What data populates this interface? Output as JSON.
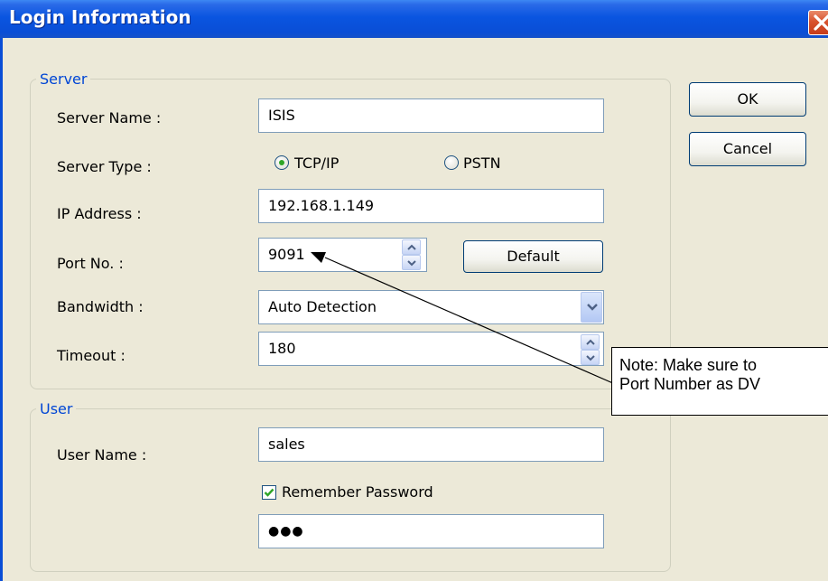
{
  "window": {
    "title": "Login Information"
  },
  "server_group": {
    "legend": "Server",
    "server_name_label": "Server Name :",
    "server_name_value": "ISIS",
    "server_type_label": "Server Type :",
    "server_type_options": [
      {
        "label": "TCP/IP",
        "selected": true
      },
      {
        "label": "PSTN",
        "selected": false
      }
    ],
    "ip_address_label": "IP Address :",
    "ip_address_value": "192.168.1.149",
    "port_label": "Port No. :",
    "port_value": "9091",
    "default_button_label": "Default",
    "bandwidth_label": "Bandwidth :",
    "bandwidth_value": "Auto Detection",
    "timeout_label": "Timeout :",
    "timeout_value": "180"
  },
  "user_group": {
    "legend": "User",
    "user_name_label": "User Name :",
    "user_name_value": "sales",
    "remember_password_label": "Remember Password",
    "remember_password_checked": true,
    "password_value": "●●●"
  },
  "buttons": {
    "ok_label": "OK",
    "cancel_label": "Cancel"
  },
  "annotation": {
    "line1": "Note: Make sure to",
    "line2": "Port Number as DV"
  },
  "colors": {
    "titlebar": "#0a4ed6",
    "dialog_background": "#ece9d8",
    "group_legend": "#0046d5",
    "radio_selected": "#2fa527",
    "checkbox_check": "#2fa527",
    "close_button": "#d8532f"
  },
  "icons": {
    "close": "close-icon",
    "spin_up": "spin-up-icon",
    "spin_down": "spin-down-icon",
    "dropdown": "chevron-down-icon",
    "checkmark": "checkmark-icon"
  }
}
